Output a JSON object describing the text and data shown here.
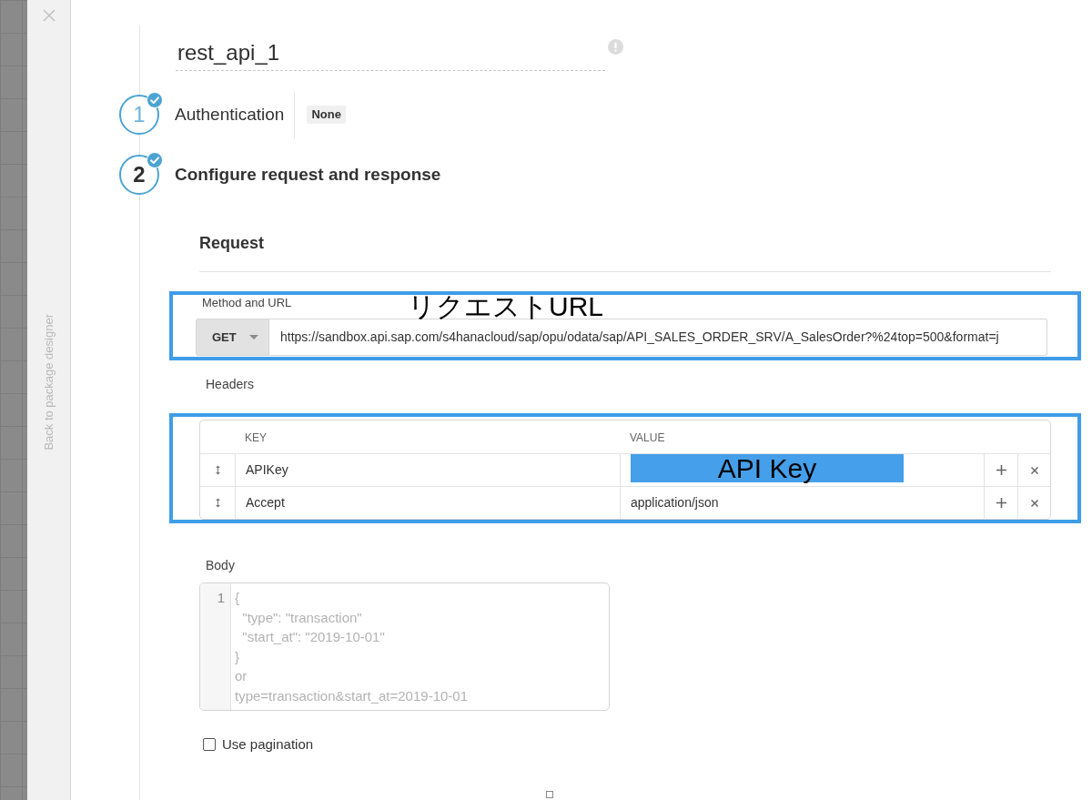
{
  "sidebar": {
    "back_link": "Back to package designer"
  },
  "connector": {
    "name": "rest_api_1"
  },
  "steps": [
    {
      "number": "1",
      "label": "Authentication",
      "completed": true,
      "selected": false,
      "value": "None"
    },
    {
      "number": "2",
      "label": "Configure request and response",
      "completed": true,
      "selected": true
    }
  ],
  "request": {
    "heading": "Request",
    "method_url": {
      "label": "Method and URL",
      "method": "GET",
      "url": "https://sandbox.api.sap.com/s4hanacloud/sap/opu/odata/sap/API_SALES_ORDER_SRV/A_SalesOrder?%24top=500&format=j",
      "highlighted": true,
      "annotation": "リクエストURL"
    },
    "headers": {
      "label": "Headers",
      "highlighted": true,
      "columns": [
        "KEY",
        "VALUE"
      ],
      "rows": [
        {
          "kind": "masked",
          "key": "APIKey",
          "mask": "API Key"
        },
        {
          "kind": "text",
          "key": "Accept",
          "value": "application/json"
        }
      ]
    },
    "body": {
      "label": "Body",
      "line_numbers": [
        "1"
      ],
      "placeholder": "{\n  \"type\": \"transaction\"\n  \"start_at\": \"2019-10-01\"\n}\nor\ntype=transaction&start_at=2019-10-01"
    },
    "pagination": {
      "label": "Use pagination",
      "checked": false
    }
  }
}
